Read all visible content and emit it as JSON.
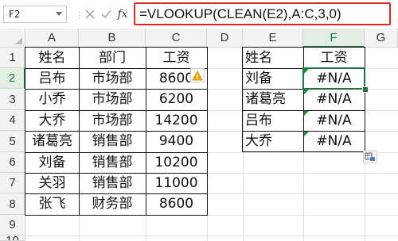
{
  "formula_bar": {
    "name_box": "F2",
    "formula": "=VLOOKUP(CLEAN(E2),A:C,3,0)",
    "fx_label": "fx"
  },
  "columns": [
    "A",
    "B",
    "C",
    "D",
    "E",
    "F",
    "G"
  ],
  "rows": [
    "1",
    "2",
    "3",
    "4",
    "5",
    "6",
    "7",
    "8",
    "9",
    "10"
  ],
  "source_table": {
    "headers": [
      "姓名",
      "部门",
      "工资"
    ],
    "rows": [
      [
        "吕布",
        "市场部",
        "8600"
      ],
      [
        "小乔",
        "市场部",
        "6200"
      ],
      [
        "大乔",
        "市场部",
        "14200"
      ],
      [
        "诸葛亮",
        "销售部",
        "9400"
      ],
      [
        "刘备",
        "销售部",
        "10200"
      ],
      [
        "关羽",
        "销售部",
        "11000"
      ],
      [
        "张飞",
        "财务部",
        "8600"
      ]
    ]
  },
  "lookup_table": {
    "headers": [
      "姓名",
      "工资"
    ],
    "rows": [
      [
        "刘备",
        "#N/A"
      ],
      [
        "诸葛亮",
        "#N/A"
      ],
      [
        "吕布",
        "#N/A"
      ],
      [
        "大乔",
        "#N/A"
      ]
    ]
  },
  "active_cell": "F2",
  "colors": {
    "formula_highlight": "#e02424",
    "selection": "#217346",
    "error_indicator": "#1e8e3e",
    "warning_icon": "#f0a500"
  }
}
